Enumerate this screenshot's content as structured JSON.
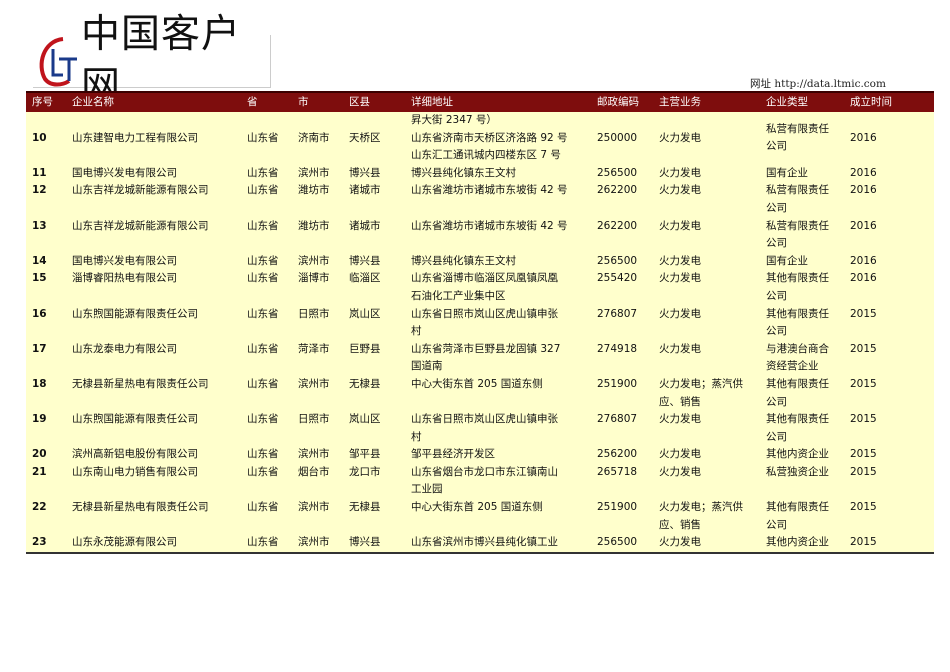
{
  "logo": {
    "mark": "LT",
    "name": "中国客户网"
  },
  "site": "网址 http://data.ltmic.com",
  "headers": [
    "序号",
    "企业名称",
    "省",
    "市",
    "区县",
    "详细地址",
    "邮政编码",
    "主营业务",
    "企业类型",
    "成立时间"
  ],
  "rows": [
    {
      "no": "10",
      "name": "山东建智电力工程有限公司",
      "prov": "山东省",
      "city": "济南市",
      "county": "天桥区",
      "addr": "昇大街 2347 号）\n山东省济南市天桥区济洛路 92 号\n山东汇工通讯城内四楼东区 7 号",
      "zip": "250000",
      "biz": "火力发电",
      "type": "私营有限责任\n公司",
      "year": "2016"
    },
    {
      "no": "11",
      "name": "国电博兴发电有限公司",
      "prov": "山东省",
      "city": "滨州市",
      "county": "博兴县",
      "addr": "博兴县纯化镇东王文村",
      "zip": "256500",
      "biz": "火力发电",
      "type": "国有企业",
      "year": "2016"
    },
    {
      "no": "12",
      "name": "山东吉祥龙城新能源有限公司",
      "prov": "山东省",
      "city": "潍坊市",
      "county": "诸城市",
      "addr": "山东省潍坊市诸城市东坡街 42 号",
      "zip": "262200",
      "biz": "火力发电",
      "type": "私营有限责任\n公司",
      "year": "2016"
    },
    {
      "no": "13",
      "name": "山东吉祥龙城新能源有限公司",
      "prov": "山东省",
      "city": "潍坊市",
      "county": "诸城市",
      "addr": "山东省潍坊市诸城市东坡街 42 号",
      "zip": "262200",
      "biz": "火力发电",
      "type": "私营有限责任\n公司",
      "year": "2016"
    },
    {
      "no": "14",
      "name": "国电博兴发电有限公司",
      "prov": "山东省",
      "city": "滨州市",
      "county": "博兴县",
      "addr": "博兴县纯化镇东王文村",
      "zip": "256500",
      "biz": "火力发电",
      "type": "国有企业",
      "year": "2016"
    },
    {
      "no": "15",
      "name": "淄博睿阳热电有限公司",
      "prov": "山东省",
      "city": "淄博市",
      "county": "临淄区",
      "addr": "山东省淄博市临淄区凤凰镇凤凰\n石油化工产业集中区",
      "zip": "255420",
      "biz": "火力发电",
      "type": "其他有限责任\n公司",
      "year": "2016"
    },
    {
      "no": "16",
      "name": "山东煦国能源有限责任公司",
      "prov": "山东省",
      "city": "日照市",
      "county": "岚山区",
      "addr": "山东省日照市岚山区虎山镇申张\n村",
      "zip": "276807",
      "biz": "火力发电",
      "type": "其他有限责任\n公司",
      "year": "2015"
    },
    {
      "no": "17",
      "name": "山东龙泰电力有限公司",
      "prov": "山东省",
      "city": "菏泽市",
      "county": "巨野县",
      "addr": "山东省菏泽市巨野县龙固镇    327\n国道南",
      "zip": "274918",
      "biz": "火力发电",
      "type": "与港澳台商合\n资经营企业",
      "year": "2015"
    },
    {
      "no": "18",
      "name": "无棣县新星热电有限责任公司",
      "prov": "山东省",
      "city": "滨州市",
      "county": "无棣县",
      "addr": "中心大街东首 205 国道东侧",
      "zip": "251900",
      "biz": "火力发电；蒸汽供\n应、销售",
      "type": "其他有限责任\n公司",
      "year": "2015"
    },
    {
      "no": "19",
      "name": "山东煦国能源有限责任公司",
      "prov": "山东省",
      "city": "日照市",
      "county": "岚山区",
      "addr": "山东省日照市岚山区虎山镇申张\n村",
      "zip": "276807",
      "biz": "火力发电",
      "type": "其他有限责任\n公司",
      "year": "2015"
    },
    {
      "no": "20",
      "name": "滨州高新铝电股份有限公司",
      "prov": "山东省",
      "city": "滨州市",
      "county": "邹平县",
      "addr": "邹平县经济开发区",
      "zip": "256200",
      "biz": "火力发电",
      "type": "其他内资企业",
      "year": "2015"
    },
    {
      "no": "21",
      "name": "山东南山电力销售有限公司",
      "prov": "山东省",
      "city": "烟台市",
      "county": "龙口市",
      "addr": "山东省烟台市龙口市东江镇南山\n工业园",
      "zip": "265718",
      "biz": "火力发电",
      "type": "私营独资企业",
      "year": "2015"
    },
    {
      "no": "22",
      "name": "无棣县新星热电有限责任公司",
      "prov": "山东省",
      "city": "滨州市",
      "county": "无棣县",
      "addr": "中心大街东首 205 国道东侧",
      "zip": "251900",
      "biz": "火力发电；蒸汽供\n应、销售",
      "type": "其他有限责任\n公司",
      "year": "2015"
    },
    {
      "no": "23",
      "name": "山东永茂能源有限公司",
      "prov": "山东省",
      "city": "滨州市",
      "county": "博兴县",
      "addr": "山东省滨州市博兴县纯化镇工业",
      "zip": "256500",
      "biz": "火力发电",
      "type": "其他内资企业",
      "year": "2015"
    }
  ]
}
